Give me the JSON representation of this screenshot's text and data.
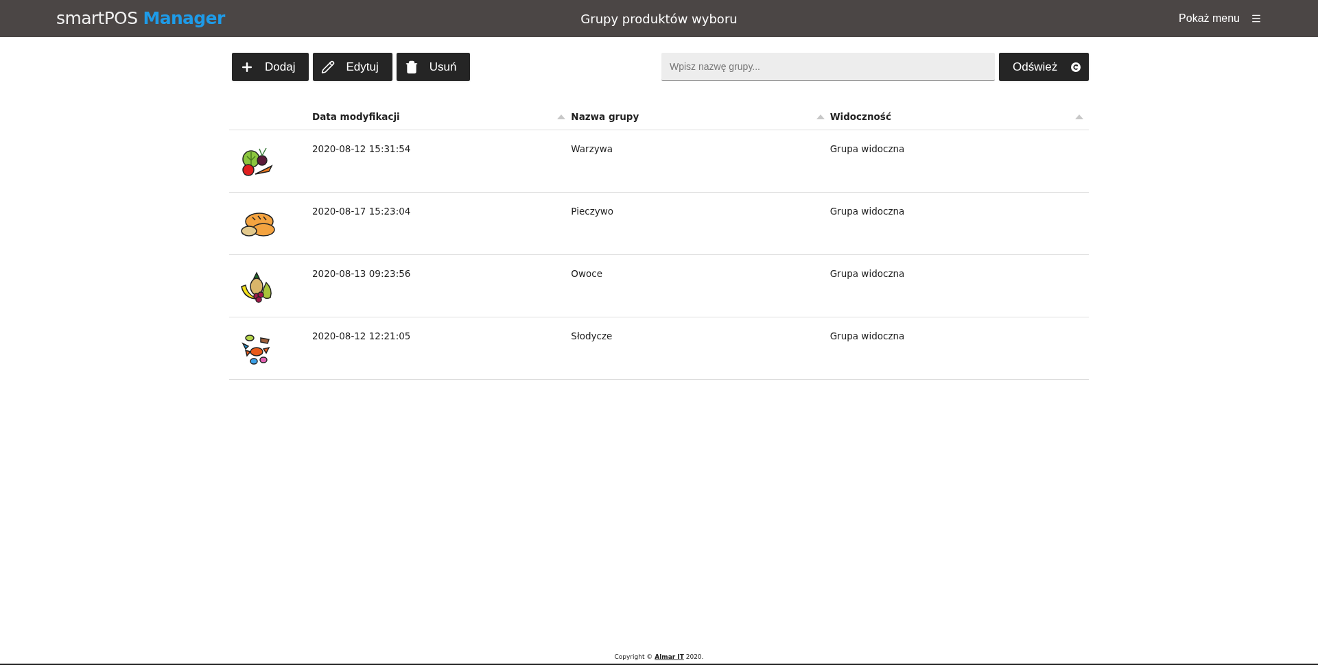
{
  "header": {
    "brand_light": "smartPOS",
    "brand_bold": "Manager",
    "title": "Grupy produktów wyboru",
    "menu_label": "Pokaż menu"
  },
  "toolbar": {
    "buttons": [
      {
        "kind": "add",
        "label": "Dodaj"
      },
      {
        "kind": "edit",
        "label": "Edytuj"
      },
      {
        "kind": "delete",
        "label": "Usuń"
      }
    ],
    "search": {
      "placeholder": "Wpisz nazwę grupy..."
    },
    "refresh": {
      "label": "Odśwież"
    }
  },
  "table": {
    "columns": [
      "Data modyfikacji",
      "Nazwa grupy",
      "Widoczność"
    ],
    "rows": [
      {
        "kind": "vegetables",
        "date": "2020-08-12 15:31:54",
        "name": "Warzywa",
        "visibility": "Grupa widoczna"
      },
      {
        "kind": "bread",
        "date": "2020-08-17 15:23:04",
        "name": "Pieczywo",
        "visibility": "Grupa widoczna"
      },
      {
        "kind": "fruit",
        "date": "2020-08-13 09:23:56",
        "name": "Owoce",
        "visibility": "Grupa widoczna"
      },
      {
        "kind": "sweets",
        "date": "2020-08-12 12:21:05",
        "name": "Słodycze",
        "visibility": "Grupa widoczna"
      }
    ]
  },
  "footer": {
    "prefix": "Copyright ©",
    "link": "Almar IT",
    "suffix": "2020."
  }
}
